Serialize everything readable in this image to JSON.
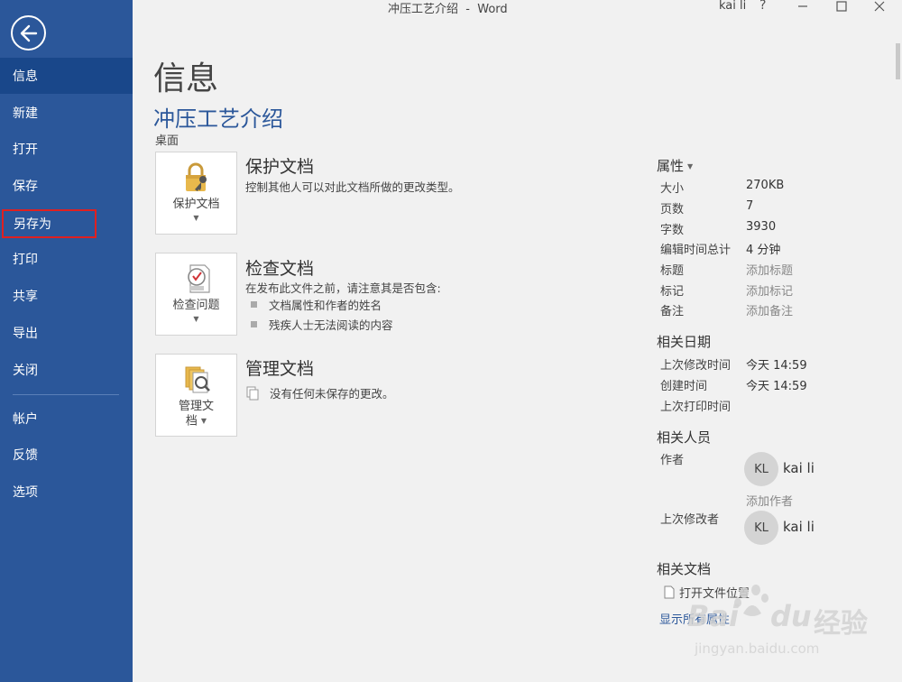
{
  "window": {
    "title": "冲压工艺介绍  -  Word",
    "user": "kai li",
    "help": "?"
  },
  "sidebar": {
    "items": [
      {
        "label": "信息"
      },
      {
        "label": "新建"
      },
      {
        "label": "打开"
      },
      {
        "label": "保存"
      },
      {
        "label": "另存为"
      },
      {
        "label": "打印"
      },
      {
        "label": "共享"
      },
      {
        "label": "导出"
      },
      {
        "label": "关闭"
      },
      {
        "label": "帐户"
      },
      {
        "label": "反馈"
      },
      {
        "label": "选项"
      }
    ]
  },
  "main": {
    "page_title": "信息",
    "doc_title": "冲压工艺介绍",
    "location": "桌面",
    "sections": [
      {
        "tile_label": "保护文档",
        "heading": "保护文档",
        "description": "控制其他人可以对此文档所做的更改类型。"
      },
      {
        "tile_label": "检查问题",
        "heading": "检查文档",
        "description": "在发布此文件之前，请注意其是否包含:",
        "bullets": [
          "文档属性和作者的姓名",
          "残疾人士无法阅读的内容"
        ]
      },
      {
        "tile_label_line1": "管理文",
        "tile_label_line2": "档",
        "heading": "管理文档",
        "description": "没有任何未保存的更改。"
      }
    ]
  },
  "properties": {
    "heading": "属性",
    "rows": [
      {
        "label": "大小",
        "value": "270KB"
      },
      {
        "label": "页数",
        "value": "7"
      },
      {
        "label": "字数",
        "value": "3930"
      },
      {
        "label": "编辑时间总计",
        "value": "4 分钟"
      },
      {
        "label": "标题",
        "value": "添加标题"
      },
      {
        "label": "标记",
        "value": "添加标记"
      },
      {
        "label": "备注",
        "value": "添加备注"
      }
    ],
    "dates_heading": "相关日期",
    "dates": [
      {
        "label": "上次修改时间",
        "value": "今天 14:59"
      },
      {
        "label": "创建时间",
        "value": "今天 14:59"
      },
      {
        "label": "上次打印时间",
        "value": ""
      }
    ],
    "people_heading": "相关人员",
    "author_label": "作者",
    "author_initials": "KL",
    "author_name": "kai li",
    "add_author": "添加作者",
    "last_modified_label": "上次修改者",
    "modifier_initials": "KL",
    "modifier_name": "kai li",
    "docs_heading": "相关文档",
    "open_location": "打开文件位置",
    "show_all": "显示所有属性"
  },
  "watermark": {
    "brand": "Bai",
    "brand_cn": "经验",
    "url": "jingyan.baidu.com"
  },
  "colors": {
    "sidebar": "#2b579a",
    "sidebar_active": "#19478a",
    "accent": "#2b579a",
    "highlight_outline": "#e02020"
  }
}
